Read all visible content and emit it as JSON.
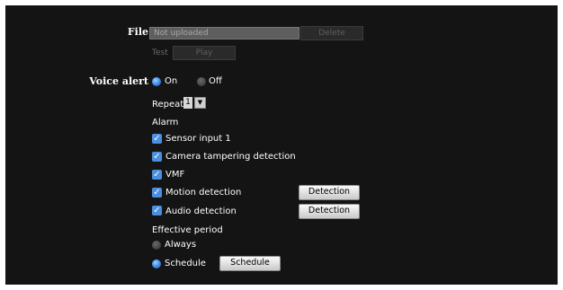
{
  "file": {
    "label": "File",
    "value": "Not uploaded",
    "delete_label": "Delete",
    "test_label": "Test",
    "play_label": "Play"
  },
  "voice_alert": {
    "label": "Voice alert",
    "on_label": "On",
    "off_label": "Off",
    "selected": "on"
  },
  "repeat": {
    "label": "Repeat",
    "value": "1"
  },
  "alarm": {
    "label": "Alarm",
    "items": [
      {
        "label": "Sensor input 1",
        "checked": true
      },
      {
        "label": "Camera tampering detection",
        "checked": true
      },
      {
        "label": "VMF",
        "checked": true
      },
      {
        "label": "Motion detection",
        "checked": true,
        "button": "Detection"
      },
      {
        "label": "Audio detection",
        "checked": true,
        "button": "Detection"
      }
    ]
  },
  "effective_period": {
    "label": "Effective period",
    "always_label": "Always",
    "schedule_label": "Schedule",
    "schedule_button": "Schedule",
    "selected": "schedule"
  },
  "colors": {
    "panel_bg": "#141414",
    "accent_blue": "#3b86e0"
  }
}
